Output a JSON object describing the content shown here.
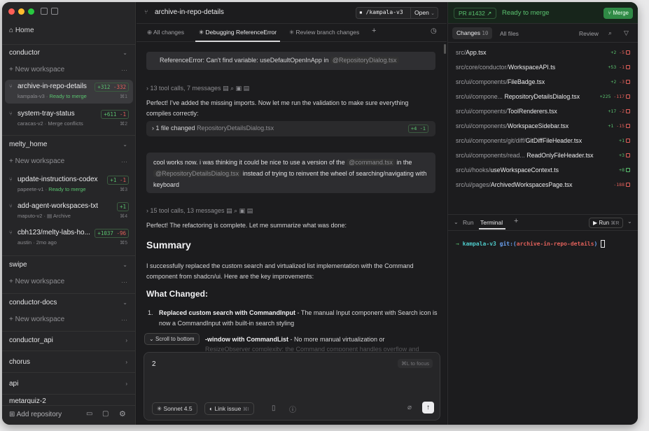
{
  "sidebar": {
    "home": "Home",
    "groups": [
      {
        "name": "conductor",
        "new": "+ New workspace"
      },
      {
        "name": "melty_home",
        "new": "+ New workspace"
      },
      {
        "name": "swipe",
        "new": "+ New workspace"
      },
      {
        "name": "conductor-docs",
        "new": "+ New workspace"
      },
      {
        "name": "conductor_api"
      },
      {
        "name": "chorus"
      },
      {
        "name": "api"
      },
      {
        "name": "metarquiz-2"
      }
    ],
    "workspaces": [
      {
        "name": "archive-in-repo-details",
        "branch": "kampala-v3",
        "status": "Ready to merge",
        "add": "+312",
        "del": "-332",
        "key": "⌘1"
      },
      {
        "name": "system-tray-status",
        "branch": "caracas-v2",
        "status": "Merge conflicts",
        "add": "+611",
        "del": "-1",
        "key": "⌘2"
      },
      {
        "name": "update-instructions-codex",
        "branch": "papeete-v1",
        "status": "Ready to merge",
        "add": "+1",
        "del": "-1",
        "key": "⌘3"
      },
      {
        "name": "add-agent-workspaces-txt",
        "branch": "maputo-v2",
        "status": "Archive",
        "add": "+1",
        "del": "",
        "key": "⌘4"
      },
      {
        "name": "cbh123/melty-labs-ho...",
        "branch": "austin",
        "status": "2mo ago",
        "add": "+1037",
        "del": "-96",
        "key": "⌘5"
      }
    ],
    "add_repository": "Add repository"
  },
  "main": {
    "title": "archive-in-repo-details",
    "path": "/kampala-v3",
    "open": "Open",
    "tabs": [
      "All changes",
      "Debugging ReferenceError",
      "Review branch changes"
    ],
    "error_text": "ReferenceError: Can't find variable: useDefaultOpenInApp in",
    "error_file": "@RepositoryDialog.tsx",
    "tool_calls_1": "13 tool calls, 7 messages",
    "msg1": "Perfect! I've added the missing imports. Now let me run the validation to make sure everything compiles correctly:",
    "file_changed": "1 file changed",
    "file_changed_name": "RepositoryDetailsDialog.tsx",
    "file_changed_diff": "+4 -1",
    "user_msg_a": "cool works now. i was thinking it could be nice to use a version of the",
    "user_msg_chip1": "@command.tsx",
    "user_msg_b": "in the",
    "user_msg_chip2": "@RepositoryDetailsDialog.tsx",
    "user_msg_c": "instead of trying to reinvent the wheel of",
    "user_msg_d": "searching/navigating with keyboard",
    "tool_calls_2": "15 tool calls, 13 messages",
    "msg2": "Perfect! The refactoring is complete. Let me summarize what was done:",
    "summary_h": "Summary",
    "summary_p": "I successfully replaced the custom search and virtualized list implementation with the Command component from shadcn/ui. Here are the key improvements:",
    "changed_h": "What Changed:",
    "item1_num": "1.",
    "item1_b": "Replaced custom search with CommandInput",
    "item1_t": " - The manual Input component with Search icon is now a CommandInput with built-in search styling",
    "item2_b": "-window with CommandList",
    "item2_t": " - No more manual virtualization or",
    "item2_t2": "ResizeObserver complexity; the Command component handles overflow and scrolling",
    "scroll_bottom": "Scroll to bottom",
    "composer_value": "2",
    "composer_hint": "⌘L to focus",
    "model": "Sonnet 4.5",
    "link_issue": "Link issue",
    "link_issue_key": "⌘I"
  },
  "right": {
    "pr": "PR #1432",
    "pr_status": "Ready to merge",
    "merge": "Merge",
    "changes_tab": "Changes",
    "changes_count": "10",
    "all_files": "All files",
    "review": "Review",
    "files": [
      {
        "dir": "src/",
        "name": "App.tsx",
        "add": "+2",
        "del": "-5"
      },
      {
        "dir": "src/core/conductor/",
        "name": "WorkspaceAPI.ts",
        "add": "+53",
        "del": "-1"
      },
      {
        "dir": "src/ui/components/",
        "name": "FileBadge.tsx",
        "add": "+2",
        "del": "-3"
      },
      {
        "dir": "src/ui/compone...",
        "name": "RepositoryDetailsDialog.tsx",
        "add": "+225",
        "del": "-117"
      },
      {
        "dir": "src/ui/components/",
        "name": "ToolRenderers.tsx",
        "add": "+17",
        "del": "-2"
      },
      {
        "dir": "src/ui/components/",
        "name": "WorkspaceSidebar.tsx",
        "add": "+1",
        "del": "-15"
      },
      {
        "dir": "src/ui/components/git/diff/",
        "name": "GitDiffFileHeader.tsx",
        "add": "+1",
        "del": ""
      },
      {
        "dir": "src/ui/components/read...",
        "name": "ReadOnlyFileHeader.tsx",
        "add": "+3",
        "del": ""
      },
      {
        "dir": "src/ui/hooks/",
        "name": "useWorkspaceContext.ts",
        "add": "+8",
        "del": ""
      },
      {
        "dir": "src/ui/pages/",
        "name": "ArchivedWorkspacesPage.tsx",
        "add": "",
        "del": "-188"
      }
    ],
    "run_tab": "Run",
    "terminal_tab": "Terminal",
    "run_btn": "Run",
    "run_key": "⌘R",
    "prompt_dir": "kampala-v3",
    "prompt_git": "git:(",
    "prompt_branch": "archive-in-repo-details",
    "prompt_close": ")"
  },
  "colors": {
    "green": "#5ac26f",
    "red": "#e0605a",
    "merge_bg": "#2f8a45"
  }
}
